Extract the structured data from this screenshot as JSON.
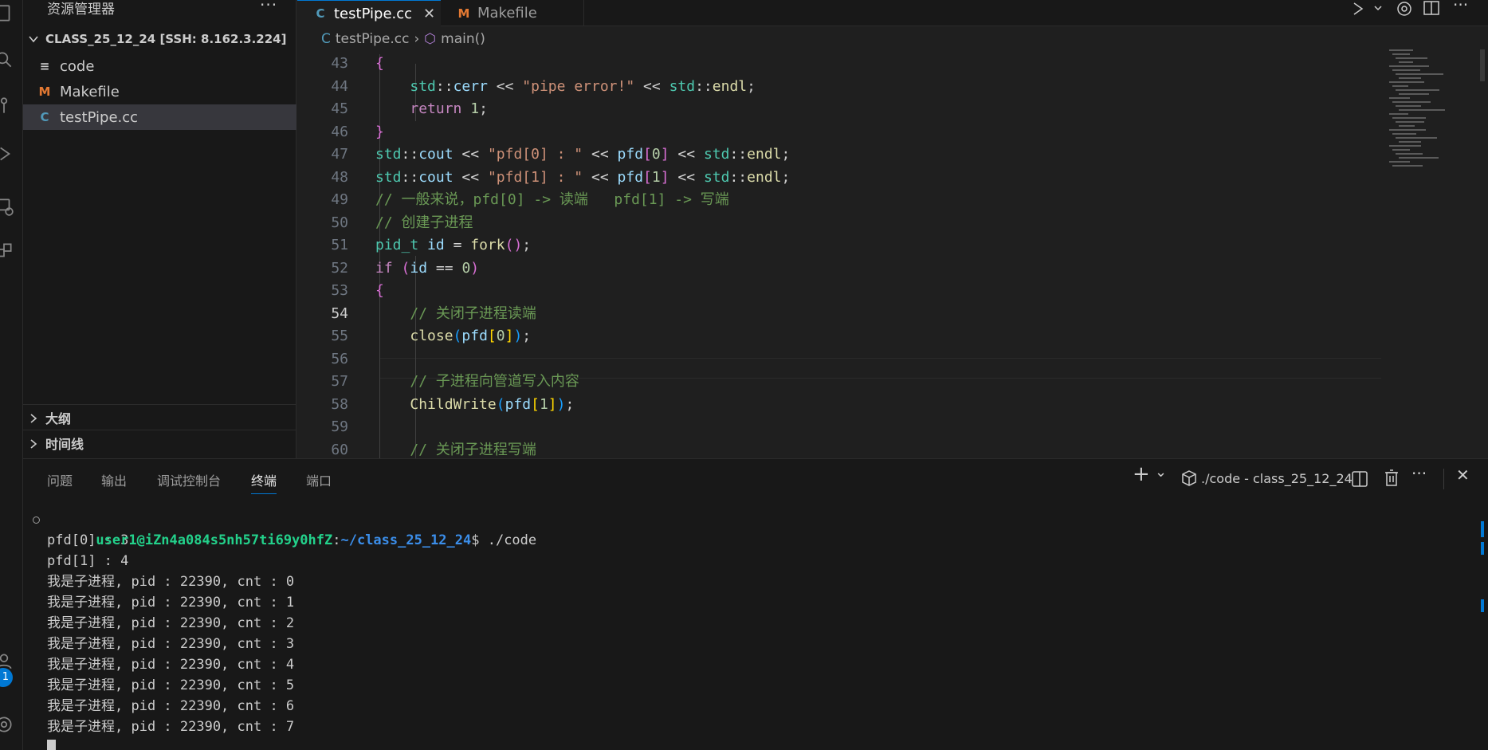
{
  "sidebar": {
    "title": "资源管理器",
    "more": "···",
    "folder": "CLASS_25_12_24 [SSH: 8.162.3.224]",
    "files": [
      {
        "name": "code",
        "icon": "≡"
      },
      {
        "name": "Makefile",
        "icon": "M"
      },
      {
        "name": "testPipe.cc",
        "icon": "C"
      }
    ],
    "sections": [
      "大纲",
      "时间线"
    ]
  },
  "tabs": [
    {
      "label": "testPipe.cc",
      "icon": "C"
    },
    {
      "label": "Makefile",
      "icon": "M"
    }
  ],
  "tab_close": "✕",
  "breadcrumb": {
    "file": "testPipe.cc",
    "symbol": "main()"
  },
  "code_lines": [
    {
      "n": "43",
      "html": "<span class=\"b1\">{</span>"
    },
    {
      "n": "44",
      "html": "    <span class=\"t\">std</span><span class=\"p\">::</span><span class=\"v\">cerr</span> <span class=\"p\">&lt;&lt;</span> <span class=\"s\">\"pipe error!\"</span> <span class=\"p\">&lt;&lt;</span> <span class=\"t\">std</span><span class=\"p\">::</span><span class=\"f\">endl</span>;"
    },
    {
      "n": "45",
      "html": "    <span class=\"k\">return</span> <span class=\"n\">1</span>;"
    },
    {
      "n": "46",
      "html": "<span class=\"b1\">}</span>"
    },
    {
      "n": "47",
      "html": "<span class=\"t\">std</span><span class=\"p\">::</span><span class=\"v\">cout</span> <span class=\"p\">&lt;&lt;</span> <span class=\"s\">\"pfd[0] : \"</span> <span class=\"p\">&lt;&lt;</span> <span class=\"v\">pfd</span><span class=\"b1\">[</span><span class=\"n\">0</span><span class=\"b1\">]</span> <span class=\"p\">&lt;&lt;</span> <span class=\"t\">std</span><span class=\"p\">::</span><span class=\"f\">endl</span>;"
    },
    {
      "n": "48",
      "html": "<span class=\"t\">std</span><span class=\"p\">::</span><span class=\"v\">cout</span> <span class=\"p\">&lt;&lt;</span> <span class=\"s\">\"pfd[1] : \"</span> <span class=\"p\">&lt;&lt;</span> <span class=\"v\">pfd</span><span class=\"b1\">[</span><span class=\"n\">1</span><span class=\"b1\">]</span> <span class=\"p\">&lt;&lt;</span> <span class=\"t\">std</span><span class=\"p\">::</span><span class=\"f\">endl</span>;"
    },
    {
      "n": "49",
      "html": "<span class=\"c\">// 一般来说，pfd[0] -&gt; 读端   pfd[1] -&gt; 写端</span>"
    },
    {
      "n": "50",
      "html": "<span class=\"c\">// 创建子进程</span>"
    },
    {
      "n": "51",
      "html": "<span class=\"t\">pid_t</span> <span class=\"v\">id</span> <span class=\"p\">=</span> <span class=\"f\">fork</span><span class=\"b1\">()</span>;"
    },
    {
      "n": "52",
      "html": "<span class=\"k\">if</span> <span class=\"b1\">(</span><span class=\"v\">id</span> <span class=\"p\">==</span> <span class=\"n\">0</span><span class=\"b1\">)</span>"
    },
    {
      "n": "53",
      "html": "<span class=\"b1\">{</span>"
    },
    {
      "n": "54",
      "html": "    <span class=\"c\">// 关闭子进程读端</span>"
    },
    {
      "n": "55",
      "html": "    <span class=\"f\">close</span><span class=\"b2\">(</span><span class=\"v\">pfd</span><span class=\"b3\">[</span><span class=\"n\">0</span><span class=\"b3\">]</span><span class=\"b2\">)</span>;"
    },
    {
      "n": "56",
      "html": ""
    },
    {
      "n": "57",
      "html": "    <span class=\"c\">// 子进程向管道写入内容</span>"
    },
    {
      "n": "58",
      "html": "    <span class=\"f\">ChildWrite</span><span class=\"b2\">(</span><span class=\"v\">pfd</span><span class=\"b3\">[</span><span class=\"n\">1</span><span class=\"b3\">]</span><span class=\"b2\">)</span>;"
    },
    {
      "n": "59",
      "html": ""
    },
    {
      "n": "60",
      "html": "    <span class=\"c\">// 关闭子进程写端</span>"
    }
  ],
  "current_line": "54",
  "panel": {
    "tabs": [
      "问题",
      "输出",
      "调试控制台",
      "终端",
      "端口"
    ],
    "active_tab": "终端",
    "terminal_label": "./code - class_25_12_24",
    "plus": "+",
    "chevron": "⌄",
    "more": "···",
    "close": "✕"
  },
  "terminal": {
    "prompt_user": "user1@iZn4a084s5nh57ti69y0hfZ",
    "prompt_sep": ":",
    "prompt_path": "~/class_25_12_24",
    "prompt_end": "$ ./code",
    "lines": [
      "pfd[0] : 3",
      "pfd[1] : 4",
      "我是子进程, pid : 22390, cnt : 0",
      "我是子进程, pid : 22390, cnt : 1",
      "我是子进程, pid : 22390, cnt : 2",
      "我是子进程, pid : 22390, cnt : 3",
      "我是子进程, pid : 22390, cnt : 4",
      "我是子进程, pid : 22390, cnt : 5",
      "我是子进程, pid : 22390, cnt : 6",
      "我是子进程, pid : 22390, cnt : 7"
    ]
  },
  "activity_badge": "1",
  "colors": {
    "accent": "#0078d4",
    "prompt_user": "#23d18b",
    "prompt_path": "#3b8eea"
  }
}
